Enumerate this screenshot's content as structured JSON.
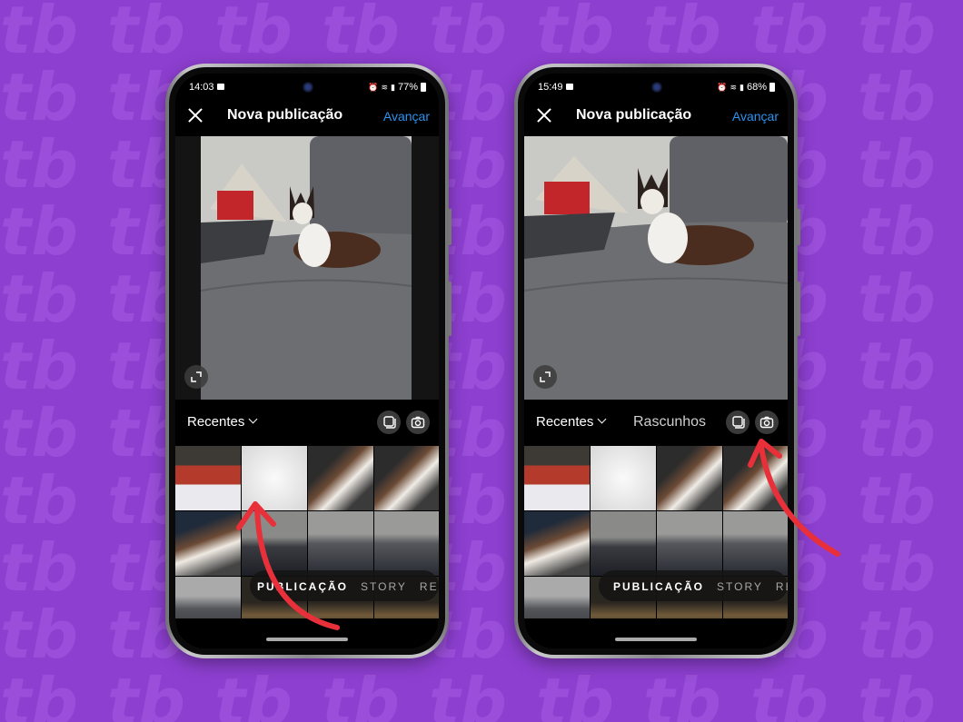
{
  "background": {
    "color": "#8d3fd0",
    "pattern_color": "#9a4ed9"
  },
  "screens": [
    {
      "status": {
        "time": "14:03",
        "battery": "77%"
      },
      "header": {
        "title": "Nova publicação",
        "next_label": "Avançar"
      },
      "album": {
        "label": "Recentes"
      },
      "modes": [
        "PUBLICAÇÃO",
        "STORY",
        "REE"
      ]
    },
    {
      "status": {
        "time": "15:49",
        "battery": "68%"
      },
      "header": {
        "title": "Nova publicação",
        "next_label": "Avançar"
      },
      "album": {
        "label": "Recentes",
        "drafts_label": "Rascunhos"
      },
      "modes": [
        "PUBLICAÇÃO",
        "STORY",
        "REE"
      ]
    }
  ],
  "colors": {
    "accent": "#2b93f0",
    "arrow": "#e8303a"
  }
}
